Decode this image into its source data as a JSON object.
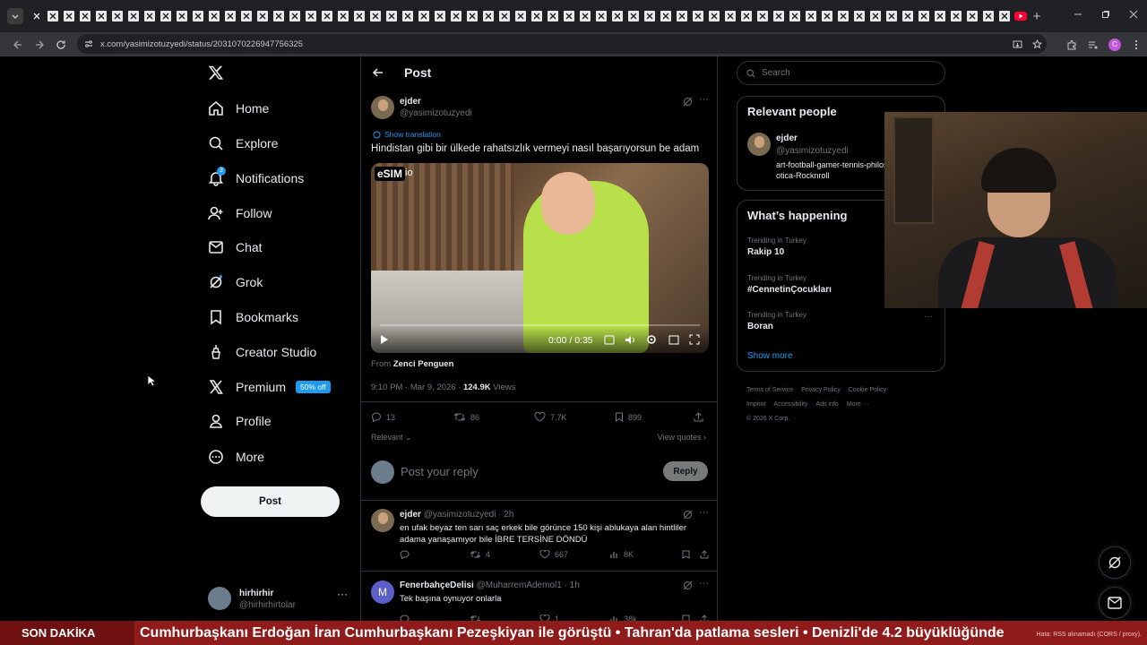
{
  "browser": {
    "address": "x.com/yasimizotuzyedi/status/2031070226947756325",
    "tab_count_x": 60,
    "new_tab": "+"
  },
  "nav": {
    "items": [
      {
        "label": "Home",
        "icon": "home-icon"
      },
      {
        "label": "Explore",
        "icon": "search-icon"
      },
      {
        "label": "Notifications",
        "icon": "bell-icon",
        "badge": "3"
      },
      {
        "label": "Follow",
        "icon": "person-plus-icon"
      },
      {
        "label": "Chat",
        "icon": "mail-icon"
      },
      {
        "label": "Grok",
        "icon": "grok-icon"
      },
      {
        "label": "Bookmarks",
        "icon": "bookmark-icon"
      },
      {
        "label": "Creator Studio",
        "icon": "creator-icon"
      },
      {
        "label": "Premium",
        "icon": "x-icon",
        "promo": "50% off"
      },
      {
        "label": "Profile",
        "icon": "person-icon"
      },
      {
        "label": "More",
        "icon": "more-circle-icon"
      }
    ],
    "post_button": "Post",
    "account": {
      "name": "hirhirhir",
      "handle": "@hirhirhirtolar",
      "more": "···"
    }
  },
  "main": {
    "header_title": "Post",
    "tweet": {
      "name": "ejder",
      "handle": "@yasimizotuzyedi",
      "show_translation": "Show translation",
      "text": "Hindistan gibi bir ülkede rahatsızlık vermeyi nasıl başarıyorsun be adam",
      "video_overlay_1": "eSIM",
      "video_overlay_2": "io",
      "video_time": "0:00 / 0:35",
      "from_label": "From",
      "from_name": "Zenci Penguen",
      "timestamp": "9:10 PM · Mar 9, 2026 · ",
      "views_count": "124.9K",
      "views_label": " Views",
      "replies": "13",
      "reposts": "86",
      "likes": "7.7K",
      "bookmarks": "899",
      "sort": "Relevant",
      "view_quotes": "View quotes"
    },
    "reply_placeholder": "Post your reply",
    "reply_button": "Reply",
    "replies": [
      {
        "name": "ejder",
        "handle": "@yasimizotuzyedi · 2h",
        "text": "en ufak beyaz ten sarı saç erkek bile görünce 150 kişi ablukaya alan hintliler adama yanaşamıyor bile İBRE TERSİNE DÖNDÜ",
        "replies": "",
        "reposts": "4",
        "likes": "667",
        "views": "8K"
      },
      {
        "name": "FenerbahçeDelisi",
        "handle": "@MuharremAdemol1 · 1h",
        "avatar_letter": "M",
        "text": "Tek başına oynuyor onlarla",
        "replies": "",
        "reposts": "",
        "likes": "1",
        "views": "38k"
      }
    ]
  },
  "right": {
    "search_placeholder": "Search",
    "relevant_title": "Relevant people",
    "person": {
      "name": "ejder",
      "handle": "@yasimizotuzyedi",
      "bio": "art-football-gamer-tennis-philosophy-erotica-Rocknroll"
    },
    "happening_title": "What’s happening",
    "trends": [
      {
        "context": "Trending in Turkey",
        "name": "Rakip 10"
      },
      {
        "context": "Trending in Turkey",
        "name": "#CennetinÇocukları"
      },
      {
        "context": "Trending in Turkey",
        "name": "Boran"
      }
    ],
    "show_more": "Show more",
    "footer": [
      "Terms of Service",
      "Privacy Policy",
      "Cookie Policy",
      "Imprint",
      "Accessibility",
      "Ads info",
      "More ···",
      "© 2026 X Corp."
    ]
  },
  "ticker": {
    "label": "SON DAKİKA",
    "news": "Cumhurbaşkanı Erdoğan İran Cumhurbaşkanı Pezeşkiyan ile görüştü   •   Tahran'da patlama sesleri   •   Denizli'de 4.2 büyüklüğünde",
    "error": "Hata: RSS alınamadı (CORS / proxy)."
  },
  "colors": {
    "accent": "#1d9bf0",
    "ticker": "#8f1b1b",
    "background": "#000000"
  }
}
